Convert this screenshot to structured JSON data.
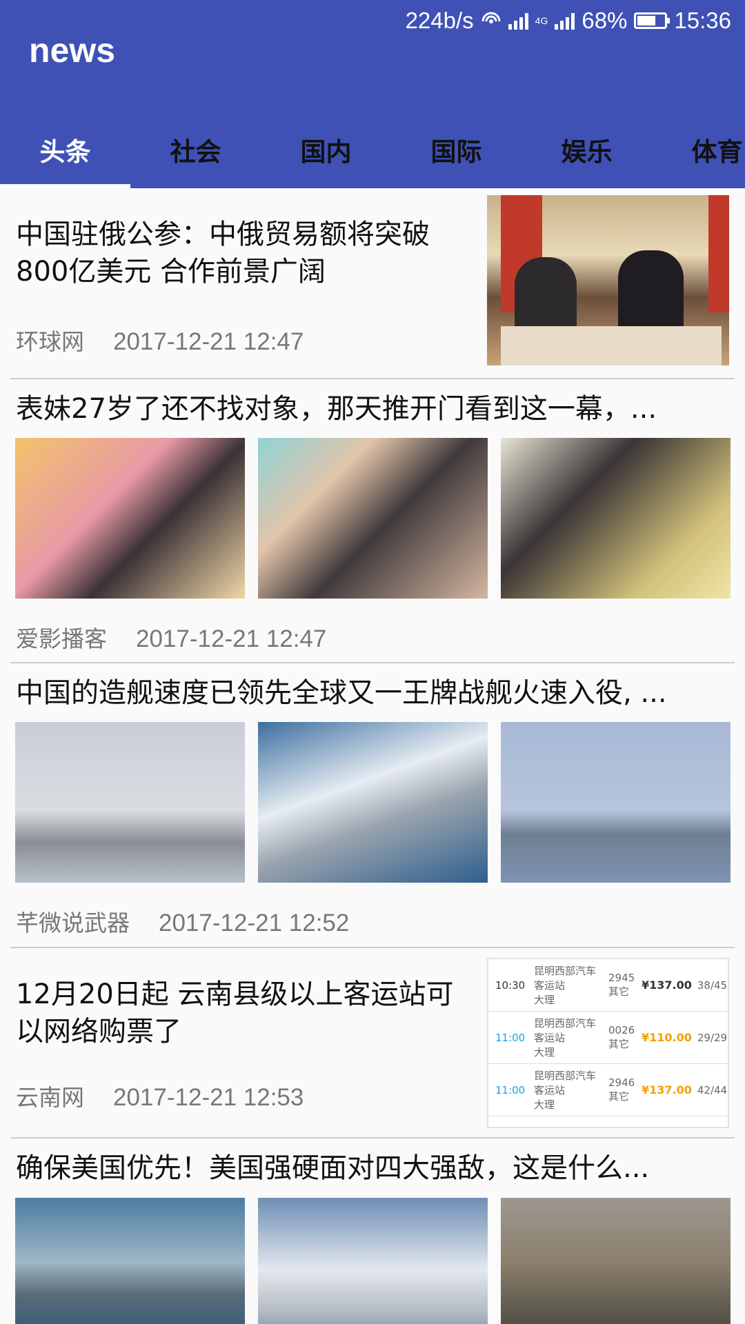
{
  "status_bar": {
    "speed": "224b/s",
    "network": "4G",
    "battery_percent": "68%",
    "battery_level": 0.68,
    "time": "15:36",
    "icons": [
      "hotspot-icon",
      "wifi-signal-icon",
      "cell-signal-icon",
      "battery-icon"
    ]
  },
  "app": {
    "title": "news"
  },
  "tabs": {
    "active_index": 0,
    "items": [
      {
        "label": "头条"
      },
      {
        "label": "社会"
      },
      {
        "label": "国内"
      },
      {
        "label": "国际"
      },
      {
        "label": "娱乐"
      },
      {
        "label": "体育"
      }
    ]
  },
  "articles": [
    {
      "layout": "single",
      "title": "中国驻俄公参：中俄贸易额将突破800亿美元 合作前景广阔",
      "source": "环球网",
      "time": "2017-12-21 12:47",
      "image": "meeting-photo"
    },
    {
      "layout": "triple",
      "title": "表妹27岁了还不找对象，那天推开门看到这一幕，...",
      "source": "爱影播客",
      "time": "2017-12-21 12:47",
      "images": [
        "pig-photo-1",
        "pig-photo-2",
        "pig-photo-3"
      ]
    },
    {
      "layout": "triple",
      "title": "中国的造舰速度已领先全球又一王牌战舰火速入役, ...",
      "source": "芊微说武器",
      "time": "2017-12-21 12:52",
      "images": [
        "warship-photo-1",
        "warship-photo-2",
        "warship-photo-3"
      ]
    },
    {
      "layout": "single",
      "title": "12月20日起 云南县级以上客运站可以网络购票了",
      "source": "云南网",
      "time": "2017-12-21 12:53",
      "image": "ticket-screenshot",
      "ticket_rows": [
        {
          "time": "10:30",
          "station": "昆明西部汽车客运站",
          "dest": "大理",
          "code": "2945",
          "type": "其它",
          "price": "¥137.00",
          "seats": "38/45"
        },
        {
          "time": "11:00",
          "station": "昆明西部汽车客运站",
          "dest": "大理",
          "code": "0026",
          "type": "其它",
          "price": "¥110.00",
          "seats": "29/29"
        },
        {
          "time": "11:00",
          "station": "昆明西部汽车客运站",
          "dest": "大理",
          "code": "2946",
          "type": "其它",
          "price": "¥137.00",
          "seats": "42/44"
        }
      ]
    },
    {
      "layout": "triple",
      "title": "确保美国优先！美国强硬面对四大强敌，这是什么...",
      "source": "",
      "time": "",
      "images": [
        "carrier-photo",
        "jet-photo",
        "soldiers-photo"
      ]
    }
  ]
}
